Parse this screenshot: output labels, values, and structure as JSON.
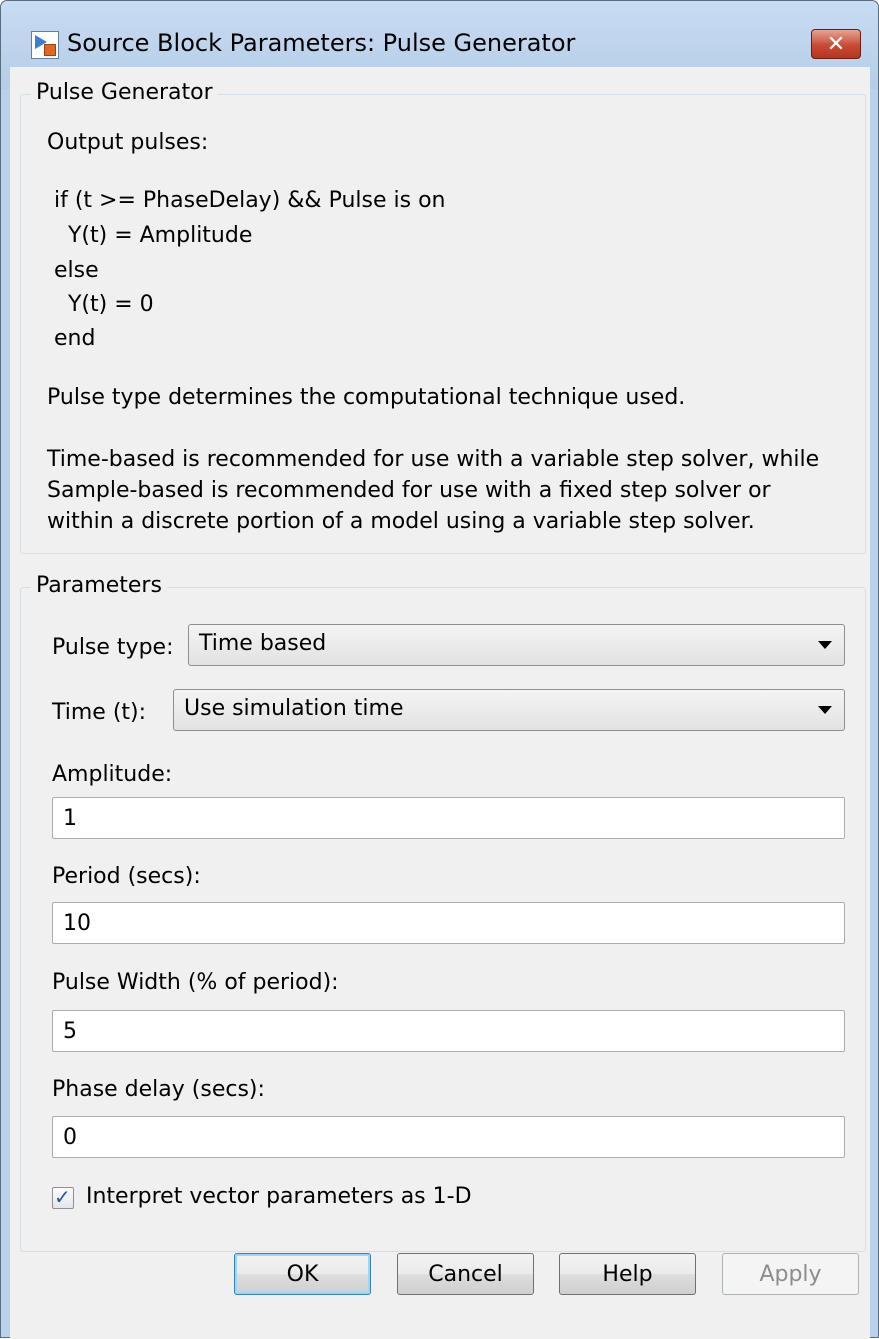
{
  "window": {
    "title": "Source Block Parameters: Pulse Generator",
    "close_glyph": "✕",
    "accent_color": "#b9d1ea"
  },
  "description_group": {
    "legend": "Pulse Generator",
    "lines": [
      "Output pulses:",
      "if (t >= PhaseDelay) && Pulse is on",
      "  Y(t) = Amplitude",
      "else",
      "  Y(t) = 0",
      "end",
      "Pulse type determines the computational technique used.",
      "Time-based is recommended for use with a variable step solver, while",
      "Sample-based is recommended for use with a fixed step solver or",
      "within a discrete portion of a model using a variable step solver."
    ]
  },
  "parameters_group": {
    "legend": "Parameters",
    "pulse_type": {
      "label": "Pulse type:",
      "value": "Time based"
    },
    "time": {
      "label": "Time (t):",
      "value": "Use simulation time"
    },
    "amplitude": {
      "label": "Amplitude:",
      "value": "1"
    },
    "period": {
      "label": "Period (secs):",
      "value": "10"
    },
    "pulse_width": {
      "label": "Pulse Width (% of period):",
      "value": "5"
    },
    "phase_delay": {
      "label": "Phase delay (secs):",
      "value": "0"
    },
    "interpret_vector": {
      "label": "Interpret vector parameters as 1-D",
      "checked": true
    }
  },
  "buttons": {
    "ok": "OK",
    "cancel": "Cancel",
    "help": "Help",
    "apply": "Apply"
  }
}
